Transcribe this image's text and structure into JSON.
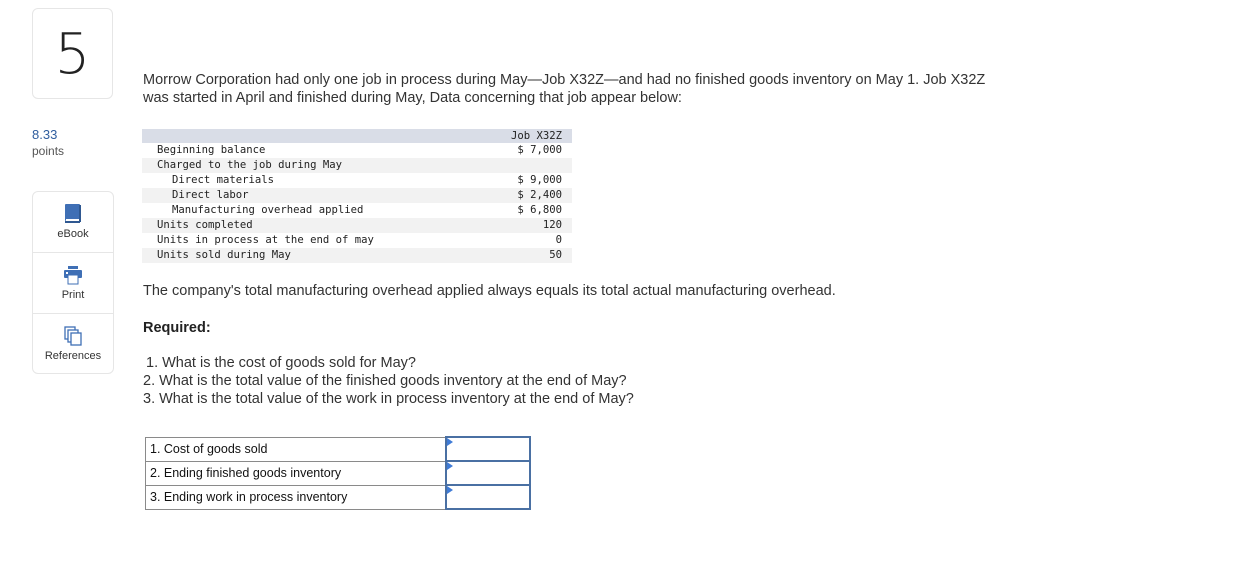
{
  "question": {
    "number": "5",
    "points_value": "8.33",
    "points_label": "points"
  },
  "tools": [
    {
      "label": "eBook",
      "icon": "book-icon"
    },
    {
      "label": "Print",
      "icon": "printer-icon"
    },
    {
      "label": "References",
      "icon": "references-icon"
    }
  ],
  "intro": {
    "line1": "Morrow Corporation had only one job in process during May—Job X32Z—and had no finished goods inventory on May 1. Job X32Z",
    "line2": "was started in April and finished during May, Data concerning that job appear below:"
  },
  "data_table": {
    "header": "Job X32Z",
    "rows": [
      {
        "label": "Beginning balance",
        "value": "$ 7,000"
      },
      {
        "label": "Charged to the job during May",
        "value": ""
      },
      {
        "label": "Direct materials",
        "value": "$ 9,000"
      },
      {
        "label": "Direct labor",
        "value": "$ 2,400"
      },
      {
        "label": "Manufacturing overhead applied",
        "value": "$ 6,800"
      },
      {
        "label": "Units completed",
        "value": "120"
      },
      {
        "label": "Units in process at the end of may",
        "value": "0"
      },
      {
        "label": "Units sold during May",
        "value": "50"
      }
    ]
  },
  "note": "The company's total manufacturing overhead applied always equals its total actual manufacturing overhead.",
  "required_label": "Required:",
  "questions": [
    "1. What is the cost of goods sold for May?",
    "2. What is the total value of the finished goods inventory at the end of May?",
    "3. What is the total value of the work in process inventory at the end of May?"
  ],
  "answers": [
    {
      "label": "1. Cost of goods sold",
      "value": ""
    },
    {
      "label": "2. Ending finished goods inventory",
      "value": ""
    },
    {
      "label": "3. Ending work in process inventory",
      "value": ""
    }
  ],
  "colors": {
    "accent": "#3f6fb5",
    "points": "#2f5d9e",
    "input_border": "#4a70a3",
    "table_header": "#d9dde7",
    "table_alt_row": "#f2f2f2"
  }
}
